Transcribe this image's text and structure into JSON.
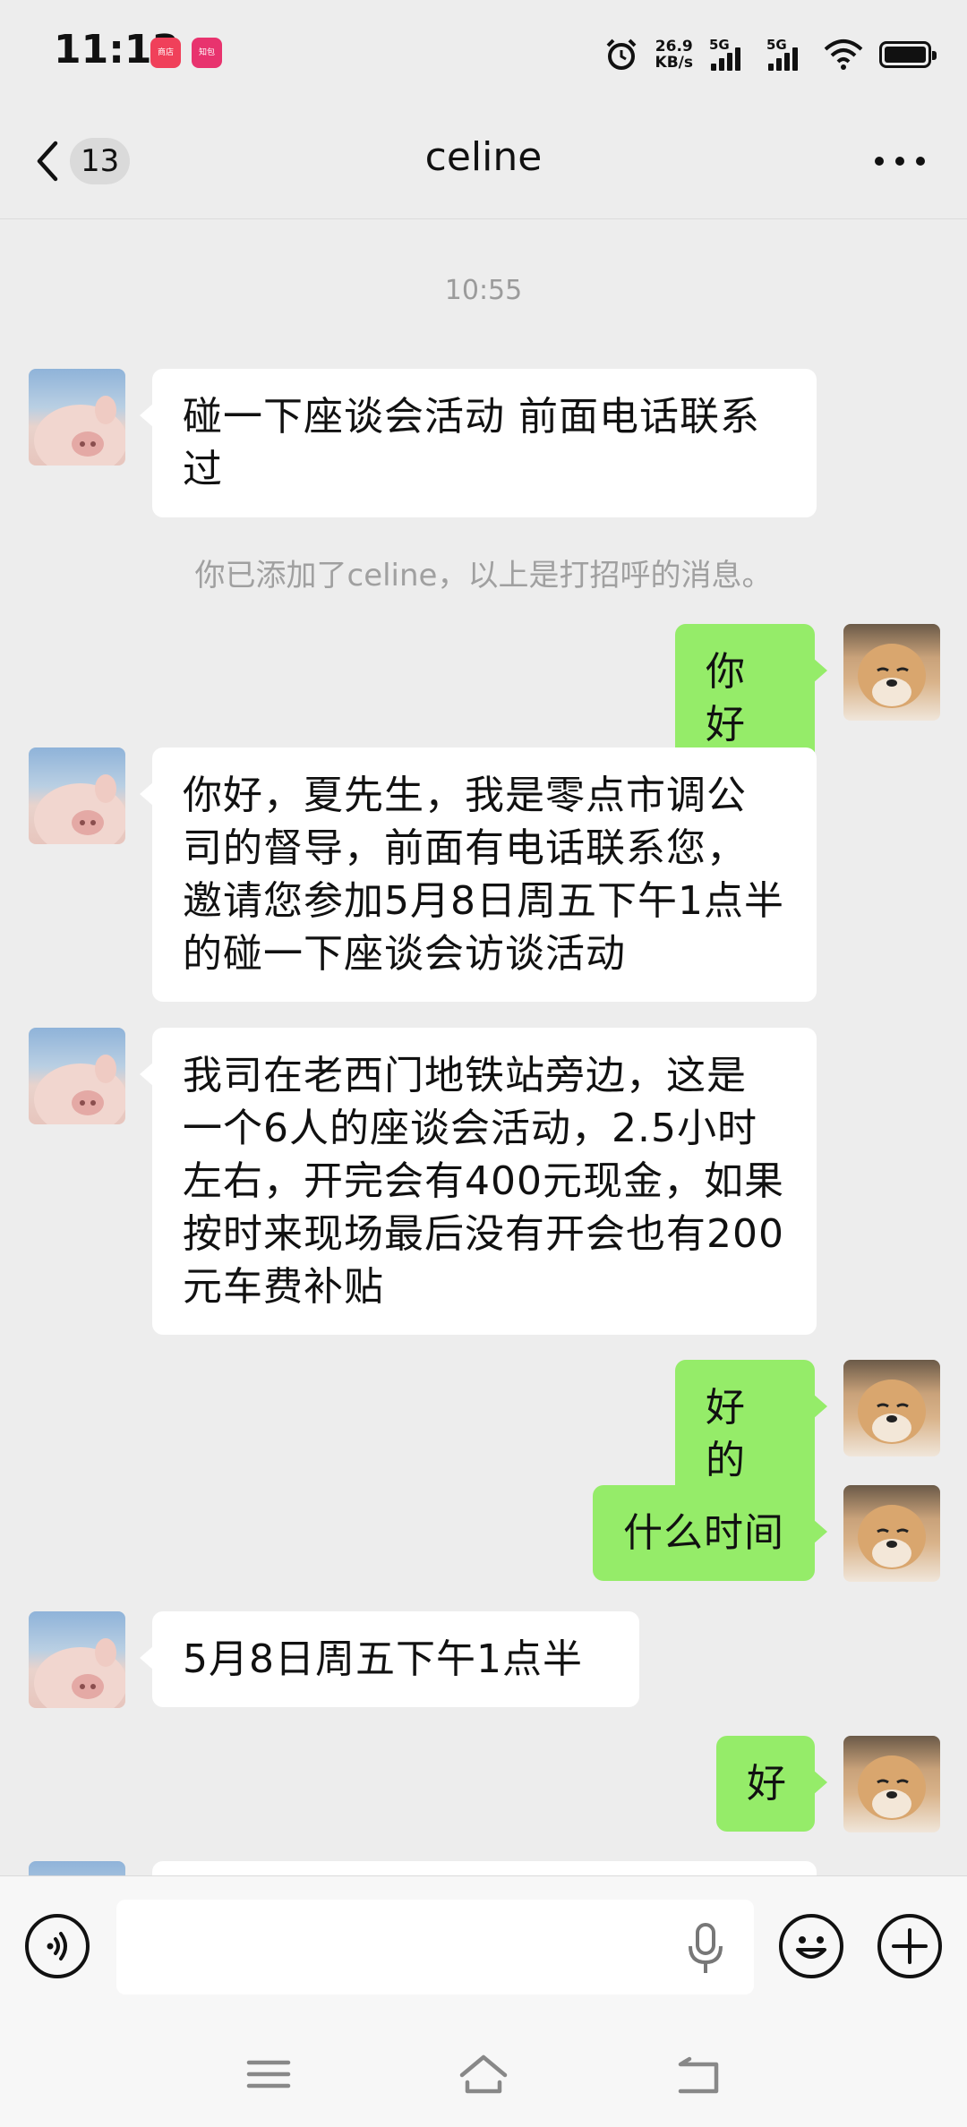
{
  "status_bar": {
    "time": "11:13",
    "app_badges": [
      {
        "label": "商店",
        "color": "#f0405a"
      },
      {
        "label": "知包",
        "color": "#e8336e"
      }
    ],
    "net_speed_value": "26.9",
    "net_speed_unit": "KB/s",
    "signal_1_label": "5G",
    "signal_2_label": "5G"
  },
  "header": {
    "unread_count": "13",
    "title": "celine"
  },
  "messages": {
    "timestamp": "10:55",
    "system_notice": "你已添加了celine，以上是打招呼的消息。",
    "m1": "碰一下座谈会活动 前面电话联系过",
    "m2": "你好",
    "m3": "你好，夏先生，我是零点市调公司的督导，前面有电话联系您，邀请您参加5月8日周五下午1点半的碰一下座谈会访谈活动",
    "m4": "我司在老西门地铁站旁边，这是一个6人的座谈会活动，2.5小时左右，开完会有400元现金，如果按时来现场最后没有开会也有200元车费补贴",
    "m5": "好的",
    "m6": "什么时间",
    "m7": "5月8日周五下午1点半",
    "m8": "好"
  },
  "input_bar": {
    "text": ""
  },
  "colors": {
    "background": "#ededed",
    "bubble_out": "#95ec69",
    "bubble_in": "#ffffff"
  }
}
